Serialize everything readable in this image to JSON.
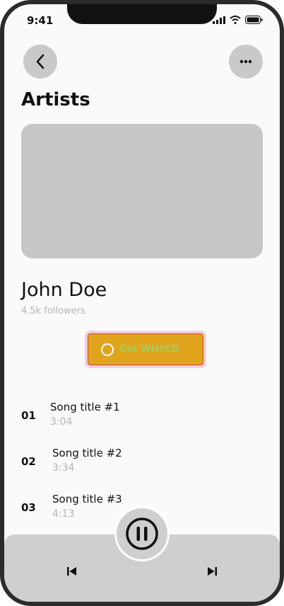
{
  "status_bar": {
    "time": "9:41",
    "icons": [
      "signal-icon",
      "wifi-icon",
      "battery-icon"
    ]
  },
  "header": {
    "back_icon": "chevron-left-icon",
    "more_icon": "ellipsis-icon",
    "title": "Artists"
  },
  "artist": {
    "name": "John Doe",
    "followers": "4.5k followers"
  },
  "action_button": {
    "label": "Get WHYCD",
    "icon": "circle-icon",
    "colors": {
      "background": "#e0a51c",
      "border": "#d93a3a",
      "label": "#a9c95a"
    }
  },
  "tracks": [
    {
      "number": "01",
      "title": "Song title #1",
      "duration": "3:04"
    },
    {
      "number": "02",
      "title": "Song title #2",
      "duration": "3:34"
    },
    {
      "number": "03",
      "title": "Song title #3",
      "duration": "4:13"
    }
  ],
  "player": {
    "pause_icon": "pause-icon",
    "prev_icon": "skip-previous-icon",
    "next_icon": "skip-next-icon"
  }
}
